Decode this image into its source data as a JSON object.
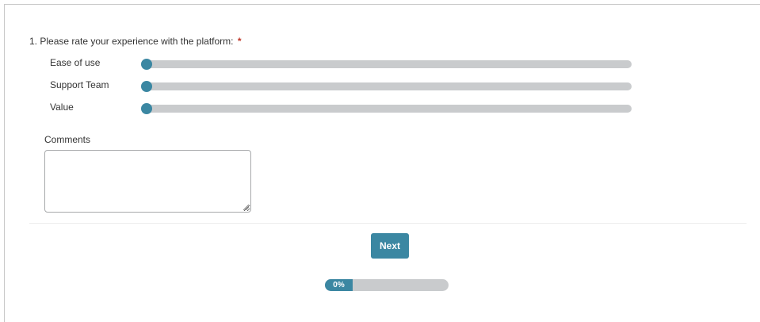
{
  "survey": {
    "question_number": "1.",
    "question_text": "Please rate your experience with the platform:",
    "required_marker": "*",
    "sliders": [
      {
        "label": "Ease of use",
        "value_fraction": 0
      },
      {
        "label": "Support Team",
        "value_fraction": 0
      },
      {
        "label": "Value",
        "value_fraction": 0
      }
    ],
    "comments": {
      "label": "Comments",
      "value": "",
      "placeholder": ""
    },
    "next_label": "Next",
    "progress": {
      "percent": 0,
      "label": "0%"
    }
  },
  "colors": {
    "accent": "#3b87a2",
    "track": "#c9cbcd",
    "required": "#c0392b"
  },
  "icons": {
    "resize_grip": "resize-grip-icon"
  }
}
